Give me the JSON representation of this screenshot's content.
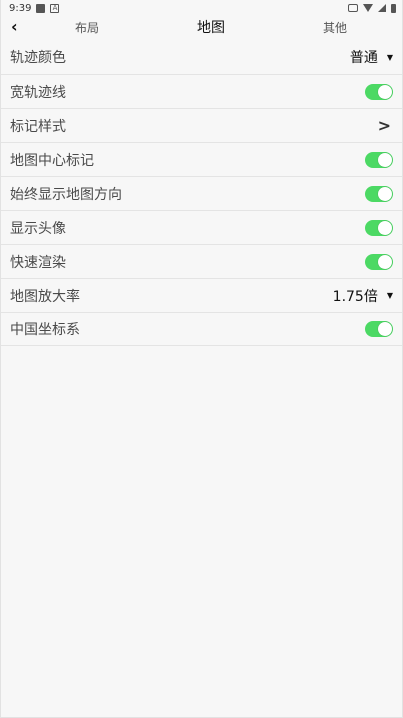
{
  "status_bar": {
    "time": "9:39",
    "icons_left": [
      "notification-square-icon",
      "a-badge-icon"
    ],
    "icons_right": [
      "vibrate-icon",
      "wifi-icon",
      "signal-icon",
      "battery-icon"
    ]
  },
  "header": {
    "back_icon": "back-arrow",
    "tabs": [
      {
        "label": "布局"
      },
      {
        "label": "地图",
        "active": true
      },
      {
        "label": "其他"
      }
    ]
  },
  "settings": {
    "rows": [
      {
        "label": "轨迹颜色",
        "type": "select",
        "value": "普通"
      },
      {
        "label": "宽轨迹线",
        "type": "toggle",
        "on": true
      },
      {
        "label": "标记样式",
        "type": "link"
      },
      {
        "label": "地图中心标记",
        "type": "toggle",
        "on": true
      },
      {
        "label": "始终显示地图方向",
        "type": "toggle",
        "on": true
      },
      {
        "label": "显示头像",
        "type": "toggle",
        "on": true
      },
      {
        "label": "快速渲染",
        "type": "toggle",
        "on": true
      },
      {
        "label": "地图放大率",
        "type": "select",
        "value": "1.75倍"
      },
      {
        "label": "中国坐标系",
        "type": "toggle",
        "on": true
      }
    ]
  },
  "colors": {
    "toggle_on": "#4cd964",
    "background": "#f7f7f7",
    "divider": "#e4e4e4"
  }
}
